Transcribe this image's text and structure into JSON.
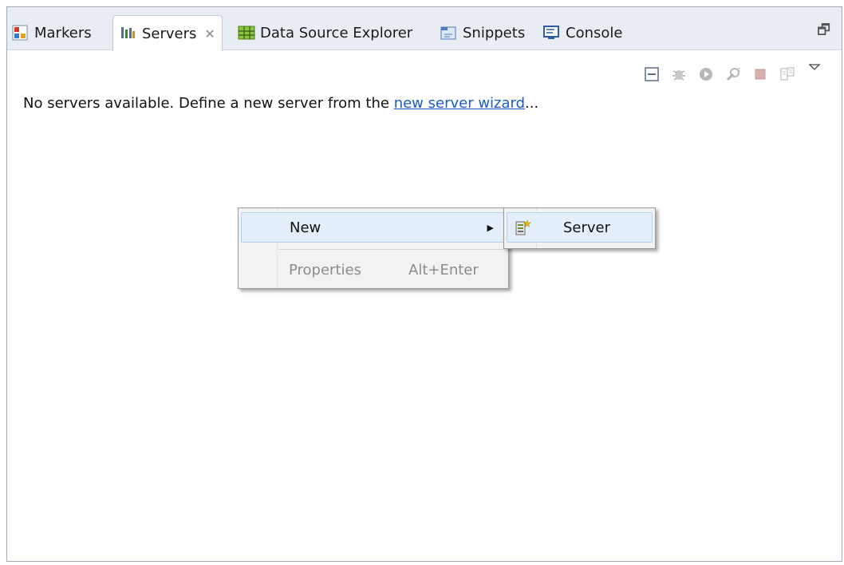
{
  "tabs": [
    {
      "label": "Markers",
      "icon": "markers-icon"
    },
    {
      "label": "Servers",
      "icon": "servers-icon",
      "active": true,
      "close": "✕"
    },
    {
      "label": "Data Source Explorer",
      "icon": "data-source-explorer-icon"
    },
    {
      "label": "Snippets",
      "icon": "snippets-icon"
    },
    {
      "label": "Console",
      "icon": "console-icon"
    }
  ],
  "maximize_glyph": "🗗",
  "message": {
    "prefix": "No servers available. Define a new server from the ",
    "link": "new server wizard",
    "suffix": "..."
  },
  "context_menu": {
    "items": [
      {
        "label": "New",
        "has_submenu": true,
        "arrow": "▶"
      },
      {
        "label": "Properties",
        "shortcut": "Alt+Enter",
        "disabled": true
      }
    ]
  },
  "submenu": {
    "items": [
      {
        "label": "Server",
        "icon": "new-server-icon"
      }
    ]
  },
  "colors": {
    "link": "#1a5cc9",
    "tabbar": "#e8edf4",
    "highlight": "#e5eefb"
  }
}
